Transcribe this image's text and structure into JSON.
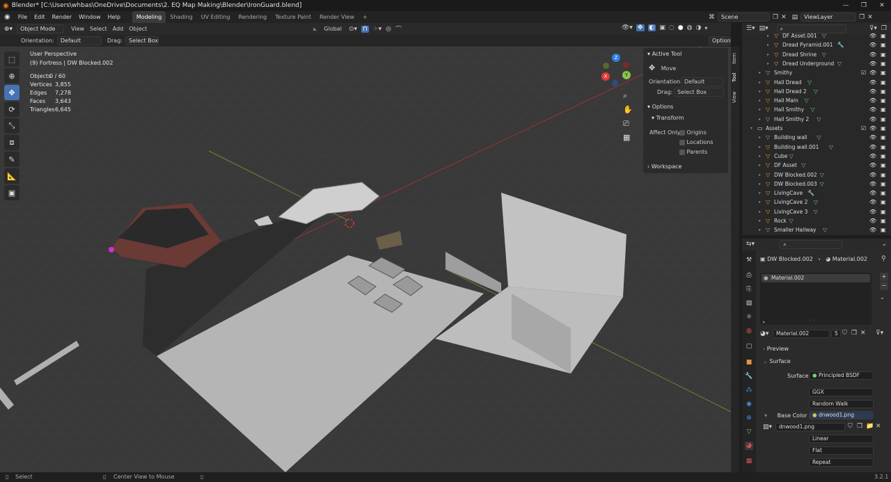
{
  "titlebar": {
    "title": "Blender* [C:\\Users\\whbas\\OneDrive\\Documents\\2. EQ Map Making\\Blender\\IronGuard.blend]",
    "controls": [
      "—",
      "❐",
      "✕"
    ]
  },
  "menubar": {
    "items": [
      "File",
      "Edit",
      "Render",
      "Window",
      "Help"
    ],
    "workspaces": [
      "Modeling",
      "Shading",
      "UV Editing",
      "Texture Paint",
      "Rendering",
      "Render View"
    ],
    "add_tab": "+",
    "scene": "Scene",
    "view_layer": "ViewLayer"
  },
  "viewport_header": {
    "mode": "Object Mode",
    "menus": [
      "View",
      "Select",
      "Add",
      "Object"
    ],
    "transform_orientation": "Global"
  },
  "tool_header": {
    "orientation_label": "Orientation:",
    "orientation_value": "Default",
    "drag_label": "Drag:",
    "drag_value": "Select Box",
    "options": "Options"
  },
  "overlay": {
    "perspective": "User Perspective",
    "collection_info": "(9) Fortress | DW Blocked.002",
    "stats": [
      {
        "label": "Objects",
        "value": "0 / 60"
      },
      {
        "label": "Vertices",
        "value": "3,855"
      },
      {
        "label": "Edges",
        "value": "7,278"
      },
      {
        "label": "Faces",
        "value": "3,643"
      },
      {
        "label": "Triangles",
        "value": "6,645"
      }
    ]
  },
  "gizmo": {
    "x": "X",
    "y": "Y",
    "z": "Z"
  },
  "npanel": {
    "active_tool_header": "Active Tool",
    "tool_name": "Move",
    "orientation_label": "Orientation",
    "orientation_value": "Default",
    "drag_label": "Drag:",
    "drag_value": "Select Box",
    "options_header": "Options",
    "transform_header": "Transform",
    "affect_only_label": "Affect Only",
    "affect_origins": "Origins",
    "affect_locations": "Locations",
    "affect_parents": "Parents",
    "workspace_header": "Workspace",
    "tabs": [
      "Item",
      "Tool",
      "View"
    ]
  },
  "outliner": {
    "rows": [
      {
        "name": "DF Asset.001",
        "indent": 3,
        "extra": "green"
      },
      {
        "name": "Dread Pyramid.001",
        "indent": 3,
        "extra": "wrench"
      },
      {
        "name": "Dread Shrine",
        "indent": 3,
        "extra": "green"
      },
      {
        "name": "Dread Underground",
        "indent": 3,
        "extra": "green"
      },
      {
        "name": "Smithy",
        "indent": 2,
        "extra": "check"
      },
      {
        "name": "Hall Dread",
        "indent": 2,
        "extra": "green"
      },
      {
        "name": "Hall Dread 2",
        "indent": 2,
        "extra": "green"
      },
      {
        "name": "Hall Main",
        "indent": 2,
        "extra": "green"
      },
      {
        "name": "Hall Smithy",
        "indent": 2,
        "extra": "green"
      },
      {
        "name": "Hall Smithy 2",
        "indent": 2,
        "extra": "green"
      },
      {
        "name": "Assets",
        "indent": 1,
        "extra": "check"
      },
      {
        "name": "Building wall",
        "indent": 2,
        "extra": "green"
      },
      {
        "name": "Building wall.001",
        "indent": 2,
        "extra": "green"
      },
      {
        "name": "Cube",
        "indent": 2,
        "extra": "green"
      },
      {
        "name": "DF Asset",
        "indent": 2,
        "extra": "green"
      },
      {
        "name": "DW Blocked.002",
        "indent": 2,
        "extra": "green"
      },
      {
        "name": "DW Blocked.003",
        "indent": 2,
        "extra": "green"
      },
      {
        "name": "LivingCave",
        "indent": 2,
        "extra": "wrench"
      },
      {
        "name": "LivingCave 2",
        "indent": 2,
        "extra": "green"
      },
      {
        "name": "LivingCave 3",
        "indent": 2,
        "extra": "green"
      },
      {
        "name": "Rock",
        "indent": 2,
        "extra": "green"
      },
      {
        "name": "Smaller Hallway",
        "indent": 2,
        "extra": "green"
      }
    ]
  },
  "properties": {
    "breadcrumb_object": "DW Blocked.002",
    "breadcrumb_material": "Material.002",
    "slot_name": "Material.002",
    "material_name": "Material.002",
    "user_count": "5",
    "preview_header": "Preview",
    "surface_header": "Surface",
    "surface_label": "Surface",
    "surface_value": "Principled BSDF",
    "distribution": "GGX",
    "subsurface_method": "Random Walk",
    "base_color_label": "Base Color",
    "base_color_value": "dnwood1.png",
    "image_name": "dnwood1.png",
    "interpolation": "Linear",
    "projection": "Flat",
    "extension": "Repeat"
  },
  "statusbar": {
    "left": "Select",
    "middle": "Center View to Mouse",
    "version": "3.2.1"
  },
  "colors": {
    "accent": "#4772b3",
    "object_orange": "#e39545",
    "mesh_green": "#6fcf6f",
    "axis_red": "#c0392b",
    "axis_green": "#7fa63a"
  }
}
